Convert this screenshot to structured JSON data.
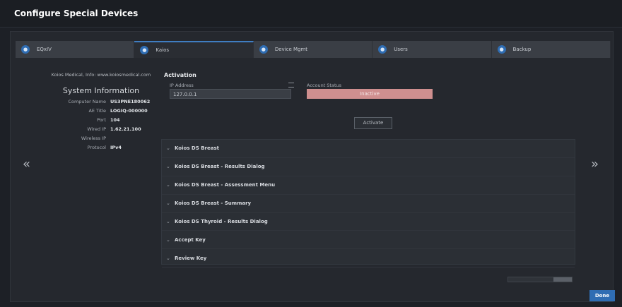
{
  "window": {
    "title": "Configure Special Devices"
  },
  "tabs": [
    {
      "label": "EQxIV",
      "icon": "circle-icon",
      "active": false
    },
    {
      "label": "Kaios",
      "icon": "circle-icon",
      "active": true
    },
    {
      "label": "Device Mgmt",
      "icon": "circle-icon",
      "active": false
    },
    {
      "label": "Users",
      "icon": "user-icon",
      "active": false
    },
    {
      "label": "Backup",
      "icon": "circle-icon",
      "active": false
    }
  ],
  "left_panel": {
    "contact": "Koios Medical, Info: www.koiosmedical.com",
    "title": "System Information",
    "fields": [
      {
        "key": "Computer Name",
        "value": "US3PNE180062"
      },
      {
        "key": "AE Title",
        "value": "LOGIQ-000000"
      },
      {
        "key": "Port",
        "value": "104"
      },
      {
        "key": "Wired IP",
        "value": "1.62.21.100"
      },
      {
        "key": "Wireless IP",
        "value": ""
      },
      {
        "key": "Protocol",
        "value": "IPv4"
      }
    ]
  },
  "activation": {
    "title": "Activation",
    "ip_label": "IP Address",
    "ip_value": "127.0.0.1",
    "account_label": "Account Status",
    "account_value": "Inactive",
    "activate_label": "Activate",
    "account_color": "#cf8f8f"
  },
  "accordion": [
    {
      "label": "Koios DS Breast"
    },
    {
      "label": "Koios DS Breast - Results Dialog"
    },
    {
      "label": "Koios DS Breast - Assessment Menu"
    },
    {
      "label": "Koios DS Breast - Summary"
    },
    {
      "label": "Koios DS Thyroid - Results Dialog"
    },
    {
      "label": "Accept Key"
    },
    {
      "label": "Review Key"
    }
  ],
  "nav": {
    "left": "«",
    "right": "»"
  },
  "footer": {
    "done_label": "Done"
  },
  "colors": {
    "accent": "#2f6db3",
    "background": "#1d2026"
  }
}
